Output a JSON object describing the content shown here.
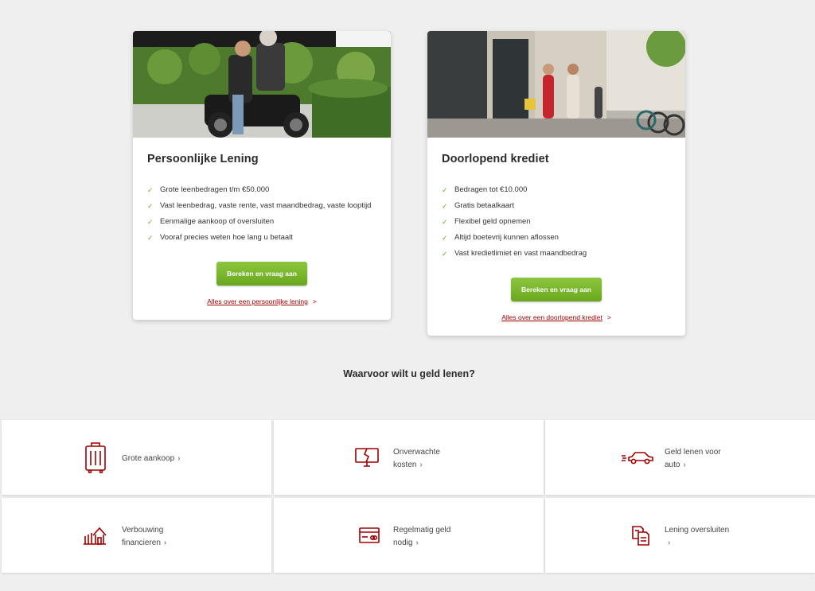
{
  "cards": [
    {
      "title": "Persoonlijke Lening",
      "features": [
        "Grote leenbedragen t/m €50.000",
        "Vast leenbedrag, vaste rente, vast maandbedrag, vaste looptijd",
        "Eenmalige aankoop of oversluiten",
        "Vooraf precies weten hoe lang u betaalt"
      ],
      "button_label": "Bereken en vraag aan",
      "more_link": "Alles over een persoonlijke lening",
      "more_arrow": ">"
    },
    {
      "title": "Doorlopend krediet",
      "features": [
        "Bedragen tot €10.000",
        "Gratis betaalkaart",
        "Flexibel geld opnemen",
        "Altijd boetevrij kunnen aflossen",
        "Vast kredietlimiet en vast maandbedrag"
      ],
      "button_label": "Bereken en vraag aan",
      "more_link": "Alles over een doorlopend krediet",
      "more_arrow": ">"
    }
  ],
  "check_glyph": "✓",
  "section_title": "Waarvoor wilt u geld lenen?",
  "tiles": [
    {
      "line1": "Grote aankoop",
      "line2": "",
      "icon": "suitcase-icon"
    },
    {
      "line1": "Onverwachte",
      "line2": "kosten",
      "icon": "broken-monitor-icon"
    },
    {
      "line1": "Geld lenen voor",
      "line2": "auto",
      "icon": "car-icon"
    },
    {
      "line1": "Verbouwing",
      "line2": "financieren",
      "icon": "house-renovation-icon"
    },
    {
      "line1": "Regelmatig geld",
      "line2": "nodig",
      "icon": "credit-card-icon"
    },
    {
      "line1": "Lening oversluiten",
      "line2": "",
      "icon": "documents-icon"
    }
  ],
  "chevron": "›",
  "colors": {
    "accent_red": "#a00000",
    "button_green": "#7ab82a",
    "check_green": "#6ab023",
    "background": "#efefef"
  }
}
